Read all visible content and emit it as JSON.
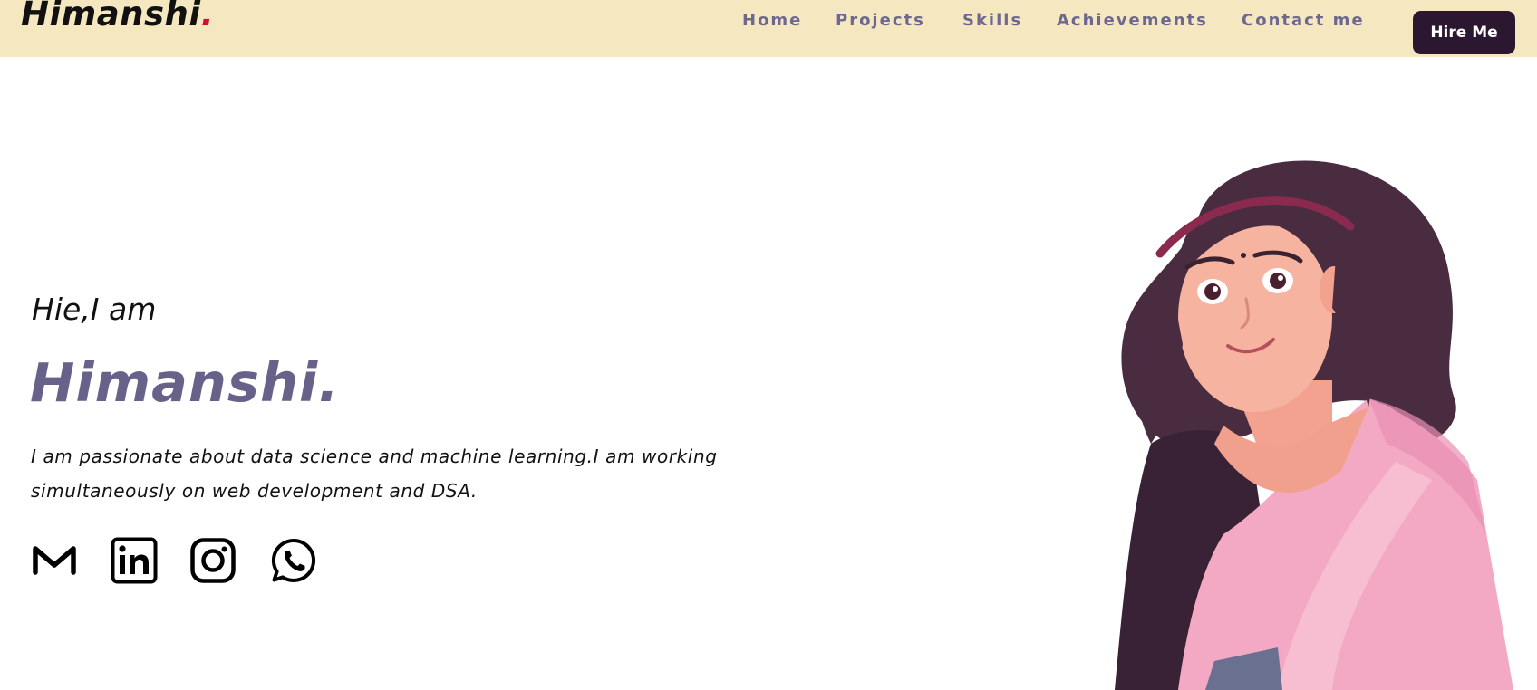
{
  "header": {
    "logo_text": "Himanshi",
    "logo_dot": ".",
    "nav": [
      {
        "label": "Home"
      },
      {
        "label": "Projects"
      },
      {
        "label": "Skills"
      },
      {
        "label": "Achievements"
      },
      {
        "label": "Contact me"
      }
    ],
    "hire_label": "Hire Me"
  },
  "hero": {
    "greeting": "Hie,I am",
    "name": "Himanshi.",
    "bio": "I am passionate about data science and machine learning.I am working simultaneously on web development and DSA."
  },
  "socials": [
    {
      "icon": "gmail-icon"
    },
    {
      "icon": "linkedin-icon"
    },
    {
      "icon": "instagram-icon"
    },
    {
      "icon": "whatsapp-icon"
    }
  ],
  "colors": {
    "navbar_bg": "#f5e8c0",
    "accent": "#67628a",
    "button_bg": "#2b1830",
    "logo_dot": "#d0103a"
  }
}
